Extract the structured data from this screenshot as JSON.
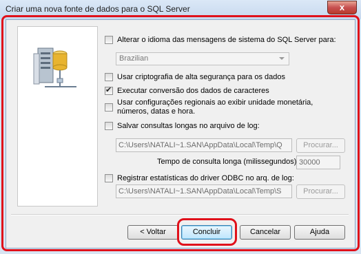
{
  "window": {
    "title": "Criar uma nova fonte de dados para o SQL Server",
    "close_glyph": "x"
  },
  "options": {
    "change_language": {
      "label": "Alterar o idioma das mensagens de sistema do SQL Server para:",
      "checked": false
    },
    "language_select": {
      "value": "Brazilian"
    },
    "strong_encryption": {
      "label": "Usar criptografia de alta segurança para os dados",
      "checked": false
    },
    "char_conversion": {
      "label": "Executar conversão dos dados de caracteres",
      "checked": true
    },
    "regional_settings": {
      "label": "Usar configurações regionais ao exibir unidade monetária, números, datas e hora.",
      "checked": false
    },
    "save_long_queries": {
      "label": "Salvar consultas longas no arquivo de log:",
      "checked": false
    },
    "long_query_path": {
      "value": "C:\\Users\\NATALI~1.SAN\\AppData\\Local\\Temp\\Q"
    },
    "browse1_label": "Procurar...",
    "long_query_time_label": "Tempo de consulta longa (milissegundos):",
    "long_query_time_value": "30000",
    "log_driver_stats": {
      "label": "Registrar estatísticas do driver ODBC no arq. de log:",
      "checked": false
    },
    "stats_path": {
      "value": "C:\\Users\\NATALI~1.SAN\\AppData\\Local\\Temp\\S"
    },
    "browse2_label": "Procurar..."
  },
  "footer": {
    "back_label": "< Voltar",
    "finish_label": "Concluir",
    "cancel_label": "Cancelar",
    "help_label": "Ajuda"
  },
  "colors": {
    "highlight_red": "#e0101a",
    "server_icon_gold": "#e8b430"
  }
}
